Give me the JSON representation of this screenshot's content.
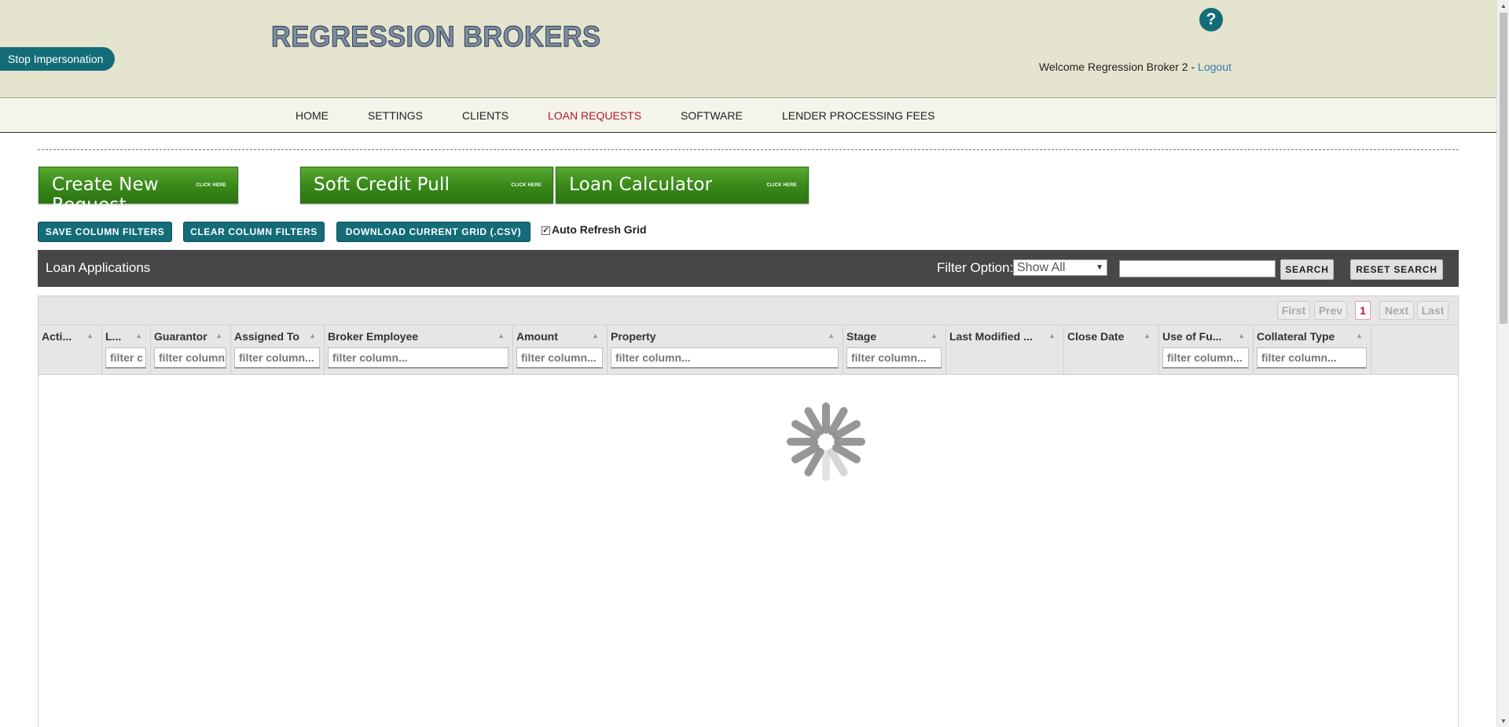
{
  "header": {
    "stop_impersonation": "Stop Impersonation",
    "logo": "REGRESSION BROKERS",
    "help": "?",
    "welcome": "Welcome Regression Broker 2 - ",
    "logout": "Logout"
  },
  "nav": {
    "items": [
      {
        "label": "HOME"
      },
      {
        "label": "SETTINGS"
      },
      {
        "label": "CLIENTS"
      },
      {
        "label": "LOAN REQUESTS"
      },
      {
        "label": "SOFTWARE"
      },
      {
        "label": "LENDER PROCESSING FEES"
      }
    ],
    "active": "LOAN REQUESTS"
  },
  "big_buttons": [
    {
      "label": "Create New Request",
      "hint": "CLICK HERE"
    },
    {
      "label": "Soft Credit Pull",
      "hint": "CLICK HERE"
    },
    {
      "label": "Loan Calculator",
      "hint": "CLICK HERE"
    }
  ],
  "actions": {
    "save_filters": "SAVE COLUMN FILTERS",
    "clear_filters": "CLEAR COLUMN FILTERS",
    "download": "DOWNLOAD CURRENT GRID (.CSV)",
    "auto_refresh": "Auto Refresh Grid",
    "auto_refresh_checked": true
  },
  "grid_bar": {
    "title": "Loan Applications",
    "filter_label": "Filter Option:",
    "filter_value": "Show All",
    "search_value": "",
    "search_button": "SEARCH",
    "reset_button": "RESET SEARCH"
  },
  "pager": {
    "first": "First",
    "prev": "Prev",
    "current": "1",
    "next": "Next",
    "last": "Last"
  },
  "columns": [
    {
      "label": "Acti...",
      "filter": ""
    },
    {
      "label": "L...",
      "filter": "filter c"
    },
    {
      "label": "Guarantor",
      "filter": "filter column"
    },
    {
      "label": "Assigned To",
      "filter": "filter column..."
    },
    {
      "label": "Broker Employee",
      "filter": "filter column..."
    },
    {
      "label": "Amount",
      "filter": "filter column..."
    },
    {
      "label": "Property",
      "filter": "filter column..."
    },
    {
      "label": "Stage",
      "filter": "filter column..."
    },
    {
      "label": "Last Modified ...",
      "filter": ""
    },
    {
      "label": "Close Date",
      "filter": ""
    },
    {
      "label": "Use of Fu...",
      "filter": "filter column..."
    },
    {
      "label": "Collateral Type",
      "filter": "filter column..."
    }
  ],
  "colors": {
    "header_bg": "#e4e4cf",
    "teal": "#146c78",
    "active_nav": "#b3172b",
    "green_button": "#3a8a1a",
    "grid_bar": "#474747"
  }
}
